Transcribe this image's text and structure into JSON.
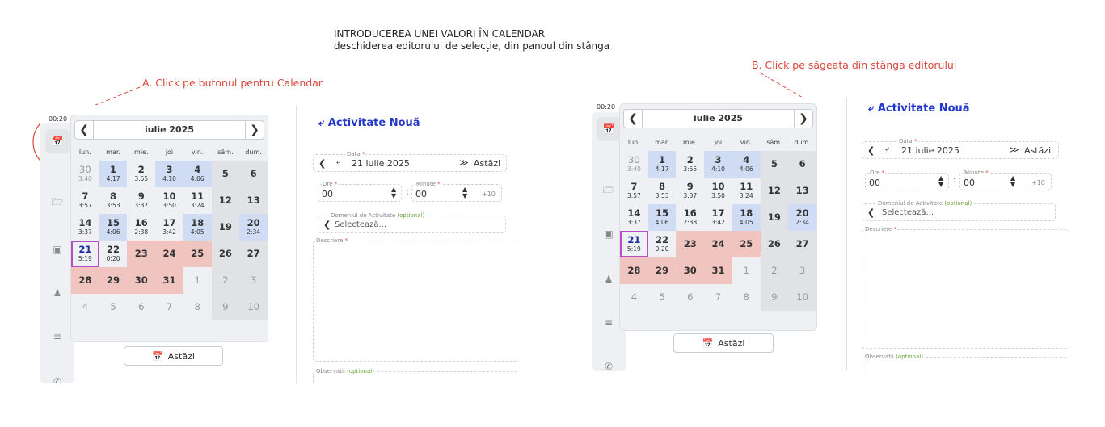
{
  "header": {
    "line1": "INTRODUCEREA UNEI VALORI ÎN CALENDAR",
    "line2": "deschiderea editorului de selecție, din panoul din stânga"
  },
  "annotations": {
    "a": "A. Click pe butonul pentru Calendar",
    "b": "B. Click pe săgeata din stânga editorului"
  },
  "colors": {
    "annotation": "#d9483b",
    "accent": "#2438c9",
    "weekend": "#cfdcf3",
    "future": "#f0c4bf",
    "today_border": "#b34fc0"
  },
  "timer": "00:20",
  "rail_icons": [
    "calendar-icon",
    "folder-icon",
    "comment-icon",
    "users-icon",
    "list-icon",
    "phone-icon"
  ],
  "calendar": {
    "prev": "❮",
    "next": "❯",
    "month": "iulie 2025",
    "weekdays": [
      "lun.",
      "mar.",
      "mie.",
      "joi",
      "vin.",
      "sâm.",
      "dum."
    ],
    "days": [
      {
        "n": "30",
        "t": "3:40",
        "c": "o"
      },
      {
        "n": "1",
        "t": "4:17",
        "c": "blue"
      },
      {
        "n": "2",
        "t": "3:55",
        "c": ""
      },
      {
        "n": "3",
        "t": "4:10",
        "c": "blue"
      },
      {
        "n": "4",
        "t": "4:06",
        "c": "blue"
      },
      {
        "n": "5",
        "t": "",
        "c": "gray"
      },
      {
        "n": "6",
        "t": "",
        "c": "gray"
      },
      {
        "n": "7",
        "t": "3:57",
        "c": ""
      },
      {
        "n": "8",
        "t": "3:53",
        "c": ""
      },
      {
        "n": "9",
        "t": "3:37",
        "c": ""
      },
      {
        "n": "10",
        "t": "3:50",
        "c": ""
      },
      {
        "n": "11",
        "t": "3:24",
        "c": ""
      },
      {
        "n": "12",
        "t": "",
        "c": "gray"
      },
      {
        "n": "13",
        "t": "",
        "c": "gray"
      },
      {
        "n": "14",
        "t": "3:37",
        "c": ""
      },
      {
        "n": "15",
        "t": "4:06",
        "c": "blue"
      },
      {
        "n": "16",
        "t": "2:38",
        "c": ""
      },
      {
        "n": "17",
        "t": "3:42",
        "c": ""
      },
      {
        "n": "18",
        "t": "4:05",
        "c": "blue"
      },
      {
        "n": "19",
        "t": "",
        "c": "gray"
      },
      {
        "n": "20",
        "t": "2:34",
        "c": "blue"
      },
      {
        "n": "21",
        "t": "5:19",
        "c": "today"
      },
      {
        "n": "22",
        "t": "0:20",
        "c": ""
      },
      {
        "n": "23",
        "t": "",
        "c": "red"
      },
      {
        "n": "24",
        "t": "",
        "c": "red"
      },
      {
        "n": "25",
        "t": "",
        "c": "red"
      },
      {
        "n": "26",
        "t": "",
        "c": "gray"
      },
      {
        "n": "27",
        "t": "",
        "c": "gray"
      },
      {
        "n": "28",
        "t": "",
        "c": "red"
      },
      {
        "n": "29",
        "t": "",
        "c": "red"
      },
      {
        "n": "30",
        "t": "",
        "c": "red"
      },
      {
        "n": "31",
        "t": "",
        "c": "red"
      },
      {
        "n": "1",
        "t": "",
        "c": "o"
      },
      {
        "n": "2",
        "t": "",
        "c": "o gray"
      },
      {
        "n": "3",
        "t": "",
        "c": "o gray"
      },
      {
        "n": "4",
        "t": "",
        "c": "o"
      },
      {
        "n": "5",
        "t": "",
        "c": "o"
      },
      {
        "n": "6",
        "t": "",
        "c": "o"
      },
      {
        "n": "7",
        "t": "",
        "c": "o"
      },
      {
        "n": "8",
        "t": "",
        "c": "o"
      },
      {
        "n": "9",
        "t": "",
        "c": "o gray"
      },
      {
        "n": "10",
        "t": "",
        "c": "o gray"
      }
    ],
    "today_label": "Astăzi"
  },
  "form": {
    "title": "Activitate Nouă",
    "title_icon": "pin-icon",
    "date_label": "Data",
    "date_value": "21 iulie 2025",
    "date_today": "Astăzi",
    "date_prev": "❮",
    "date_jump": "≫",
    "hour_label": "Ore",
    "hour_value": "00",
    "minute_label": "Minute",
    "minute_value": "00",
    "plus10": "+10",
    "colon": ":",
    "stepper": "⌃⌄",
    "domain_label": "Domeniul de Activitate",
    "domain_opt": "(optional)",
    "domain_placeholder": "Selectează...",
    "domain_prev": "❮",
    "desc_label": "Descriere",
    "obs_label": "Observatii",
    "obs_opt": "(optional)",
    "req": "*"
  }
}
